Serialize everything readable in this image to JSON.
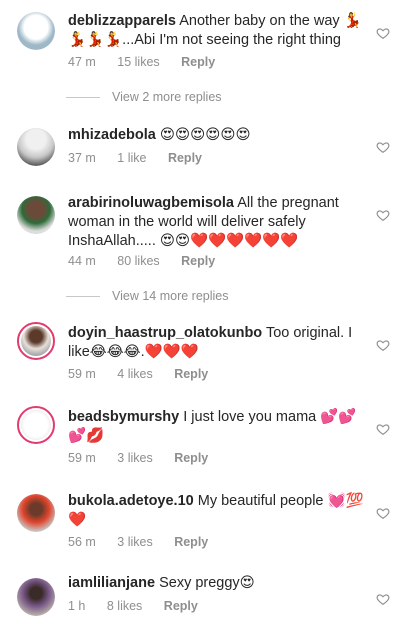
{
  "comments": [
    {
      "user": "deblizzapparels",
      "text": "Another baby on the way 💃💃💃💃...Abi I'm not seeing the right thing",
      "time": "47 m",
      "likes": "15 likes",
      "reply": "Reply"
    },
    {
      "user": "mhizadebola",
      "text": "😍😍😍😍😍😍",
      "time": "37 m",
      "likes": "1 like",
      "reply": "Reply"
    },
    {
      "user": "arabirinoluwagbemisola",
      "text": "All the pregnant woman in the world will deliver safely InshaAllah..... 😍😍❤️❤️❤️❤️❤️❤️",
      "time": "44 m",
      "likes": "80 likes",
      "reply": "Reply"
    },
    {
      "user": "doyin_haastrup_olatokunbo",
      "text": "Too original. I like😂😂😂.❤️❤️❤️",
      "time": "59 m",
      "likes": "4 likes",
      "reply": "Reply"
    },
    {
      "user": "beadsbymurshy",
      "text": "I just love you mama 💕💕💕💋",
      "time": "59 m",
      "likes": "3 likes",
      "reply": "Reply"
    },
    {
      "user": "bukola.adetoye.10",
      "text": "My beautiful people 💓💯❤️",
      "time": "56 m",
      "likes": "3 likes",
      "reply": "Reply"
    },
    {
      "user": "iamlilianjane",
      "text": "Sexy preggy😍",
      "time": "1 h",
      "likes": "8 likes",
      "reply": "Reply"
    }
  ],
  "view_more": [
    "View 2 more replies",
    "View 14 more replies"
  ],
  "icons": {
    "like": "heart-outline-icon"
  },
  "colors": {
    "text": "#262626",
    "meta": "#8e8e8e",
    "story_ring": "#e23b6d"
  }
}
